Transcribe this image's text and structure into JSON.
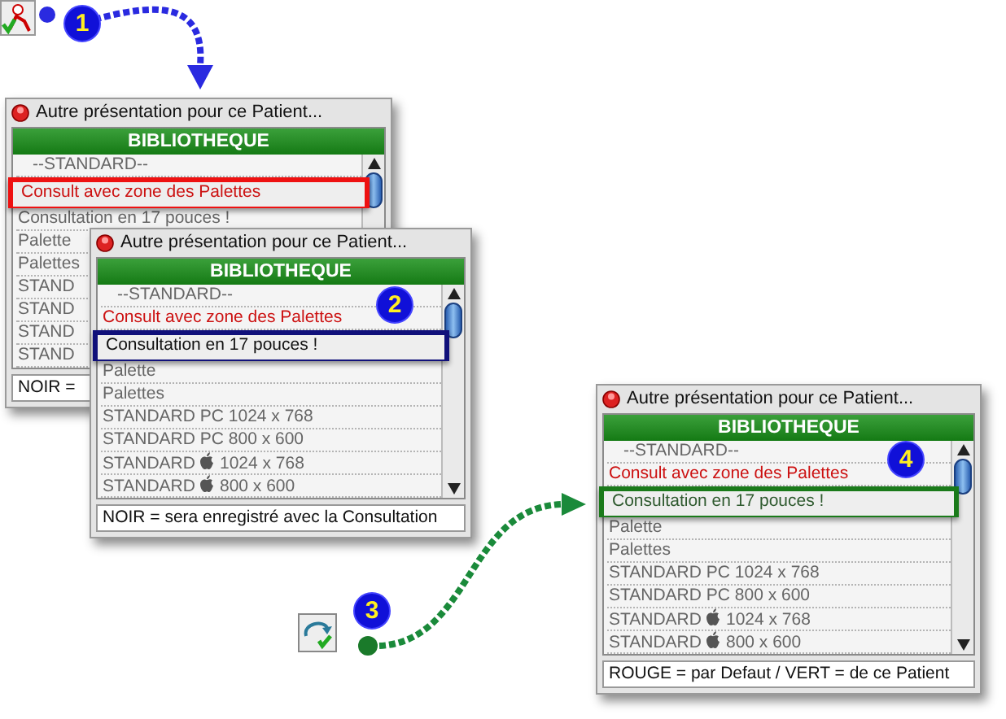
{
  "windows": [
    {
      "title": "Autre présentation pour ce Patient...",
      "header": "BIBLIOTHEQUE",
      "frame": {
        "color": "#ee1111"
      },
      "footer": "NOIR =",
      "rows": [
        {
          "kind": "plain",
          "text": "--STANDARD--",
          "color": "#666666",
          "highlighted": false
        },
        {
          "kind": "plain",
          "text": "Consult avec zone des Palettes",
          "color": "#cc1111",
          "highlighted": true
        },
        {
          "kind": "plain",
          "text": "Consultation en 17 pouces !",
          "color": "#666666",
          "highlighted": false
        },
        {
          "kind": "plain",
          "text": "Palette",
          "color": "#666666",
          "highlighted": false
        },
        {
          "kind": "plain",
          "text": "Palettes",
          "color": "#666666",
          "highlighted": false
        },
        {
          "kind": "plain",
          "text": "STAND",
          "color": "#666666",
          "highlighted": false
        },
        {
          "kind": "plain",
          "text": "STAND",
          "color": "#666666",
          "highlighted": false
        },
        {
          "kind": "plain",
          "text": "STAND",
          "color": "#666666",
          "highlighted": false
        },
        {
          "kind": "plain",
          "text": "STAND",
          "color": "#666666",
          "highlighted": false
        }
      ]
    },
    {
      "title": "Autre présentation pour ce Patient...",
      "header": "BIBLIOTHEQUE",
      "frame": {
        "color": "#10107a"
      },
      "footer": "NOIR = sera enregistré avec la Consultation",
      "rows": [
        {
          "kind": "plain",
          "text": "--STANDARD--",
          "color": "#666666",
          "highlighted": false
        },
        {
          "kind": "plain",
          "text": "Consult avec zone des Palettes",
          "color": "#cc1111",
          "highlighted": false
        },
        {
          "kind": "plain",
          "text": "Consultation en 17 pouces !",
          "color": "#111111",
          "highlighted": true
        },
        {
          "kind": "plain",
          "text": "Palette",
          "color": "#666666",
          "highlighted": false
        },
        {
          "kind": "plain",
          "text": "Palettes",
          "color": "#666666",
          "highlighted": false
        },
        {
          "kind": "plain",
          "text": "STANDARD PC 1024 x 768",
          "color": "#666666",
          "highlighted": false
        },
        {
          "kind": "plain",
          "text": "STANDARD PC 800 x 600",
          "color": "#666666",
          "highlighted": false
        },
        {
          "kind": "apple",
          "text": "STANDARD",
          "after": "1024 x 768",
          "color": "#666666",
          "highlighted": false
        },
        {
          "kind": "apple",
          "text": "STANDARD",
          "after": "800 x 600",
          "color": "#666666",
          "highlighted": false
        }
      ]
    },
    {
      "title": "Autre présentation pour ce Patient...",
      "header": "BIBLIOTHEQUE",
      "frame": {
        "color": "#1a7a1a"
      },
      "footer": "ROUGE = par Defaut / VERT = de ce Patient",
      "rows": [
        {
          "kind": "plain",
          "text": "--STANDARD--",
          "color": "#666666",
          "highlighted": false
        },
        {
          "kind": "plain",
          "text": "Consult avec zone des Palettes",
          "color": "#cc1111",
          "highlighted": false
        },
        {
          "kind": "plain",
          "text": "Consultation en 17 pouces !",
          "color": "#2f5a2f",
          "highlighted": true
        },
        {
          "kind": "plain",
          "text": "Palette",
          "color": "#666666",
          "highlighted": false
        },
        {
          "kind": "plain",
          "text": "Palettes",
          "color": "#666666",
          "highlighted": false
        },
        {
          "kind": "plain",
          "text": "STANDARD PC 1024 x 768",
          "color": "#666666",
          "highlighted": false
        },
        {
          "kind": "plain",
          "text": "STANDARD PC 800 x 600",
          "color": "#666666",
          "highlighted": false
        },
        {
          "kind": "apple",
          "text": "STANDARD",
          "after": "1024 x 768",
          "color": "#666666",
          "highlighted": false
        },
        {
          "kind": "apple",
          "text": "STANDARD",
          "after": "800 x 600",
          "color": "#666666",
          "highlighted": false
        }
      ]
    }
  ],
  "badges": [
    {
      "label": "1"
    },
    {
      "label": "2"
    },
    {
      "label": "3"
    },
    {
      "label": "4"
    }
  ]
}
